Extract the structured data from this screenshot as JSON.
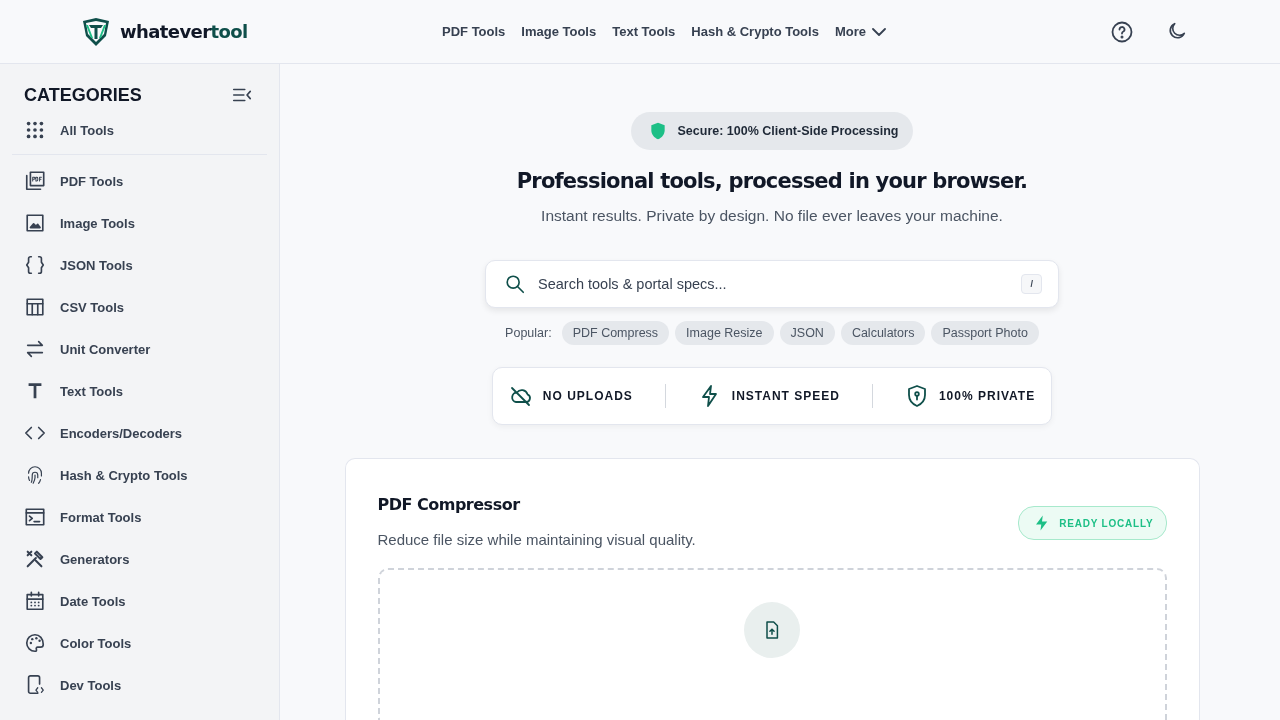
{
  "brand": {
    "name": "whatever",
    "accent": "tool"
  },
  "nav": [
    {
      "label": "PDF Tools",
      "kind": "link"
    },
    {
      "label": "Image Tools",
      "kind": "link"
    },
    {
      "label": "Text Tools",
      "kind": "link"
    },
    {
      "label": "Hash & Crypto Tools",
      "kind": "link"
    },
    {
      "label": "More",
      "kind": "dropdown"
    }
  ],
  "sidebar": {
    "title": "CATEGORIES",
    "items": [
      {
        "label": "All Tools"
      },
      {
        "label": "PDF Tools"
      },
      {
        "label": "Image Tools"
      },
      {
        "label": "JSON Tools"
      },
      {
        "label": "CSV Tools"
      },
      {
        "label": "Unit Converter"
      },
      {
        "label": "Text Tools"
      },
      {
        "label": "Encoders/Decoders"
      },
      {
        "label": "Hash & Crypto Tools"
      },
      {
        "label": "Format Tools"
      },
      {
        "label": "Generators"
      },
      {
        "label": "Date Tools"
      },
      {
        "label": "Color Tools"
      },
      {
        "label": "Dev Tools"
      }
    ]
  },
  "hero": {
    "badge": "Secure: 100% Client-Side Processing",
    "title": "Professional tools, processed in your browser.",
    "subtitle": "Instant results. Private by design. No file ever leaves your machine.",
    "search": {
      "placeholder": "Search tools & portal specs...",
      "shortcut": "/"
    },
    "popular_label": "Popular:",
    "popular": [
      "PDF Compress",
      "Image Resize",
      "JSON",
      "Calculators",
      "Passport Photo"
    ],
    "features": [
      {
        "label": "NO UPLOADS"
      },
      {
        "label": "INSTANT SPEED"
      },
      {
        "label": "100% PRIVATE"
      }
    ]
  },
  "card": {
    "title": "PDF Compressor",
    "description": "Reduce file size while maintaining visual quality.",
    "status": "READY LOCALLY"
  }
}
